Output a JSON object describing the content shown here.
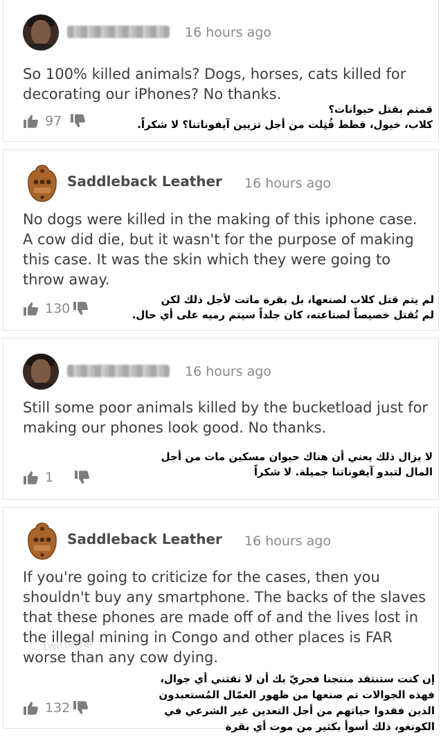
{
  "comments": [
    {
      "author_type": "blurred",
      "time": "16 hours ago",
      "body": "So 100% killed animals? Dogs, horses, cats killed for decorating our iPhones? No thanks.",
      "likes": "97",
      "translation": "قمتم بقتل حيوانات؟\nكلاب، خيول، قطط قُتِلت من أجل تزيين آيفوناتنا؟ لا شكراً."
    },
    {
      "author": "Saddleback Leather",
      "time": "16 hours ago",
      "body": "No dogs were killed in the making of this iphone case. A cow did die, but it wasn't for the purpose of making this case. It was the skin which they were going to throw away.",
      "likes": "130",
      "translation": "لم يتم قتل كلاب لصنعها، بل بقرة ماتت لأجل ذلك لكن\nلم تُقتل خصيصاً لصناعته، كان جلداً سيتم رميه على أي حال."
    },
    {
      "author_type": "blurred",
      "time": "16 hours ago",
      "body": "Still some poor animals killed by the bucketload just for making our phones look good. No thanks.",
      "likes": "1",
      "translation": "لا يزال ذلك يعني أن هناك حيوان مسكين مات من أجل\nالمال لتبدو آيفوناتنا جميلة. لا شكراً"
    },
    {
      "author": "Saddleback Leather",
      "time": "16 hours ago",
      "body": "If you're going to criticize for the cases, then you shouldn't buy any smartphone. The backs of the slaves that these phones are made off of and the lives lost in the illegal mining in Congo and other places is FAR worse than any cow dying.",
      "likes": "132",
      "translation": "إن كنت ستنتقد منتجنا فحريّ بك أن لا تقتني أي جوال،\nفهذه الجوالات تم صنعها من ظهور العمّال المُستعبدون\nالذين فقدوا حياتهم من أجل التعدين غير الشرعي في\nالكونغو، ذلك أسوأ بكثير من موت أي بقرة"
    }
  ],
  "watermark": "twitter/@ ...",
  "colors": {
    "text": "#3c3c3c",
    "meta": "#8a8a8a",
    "author": "#4a4a4a",
    "logo": "#a8642a"
  }
}
